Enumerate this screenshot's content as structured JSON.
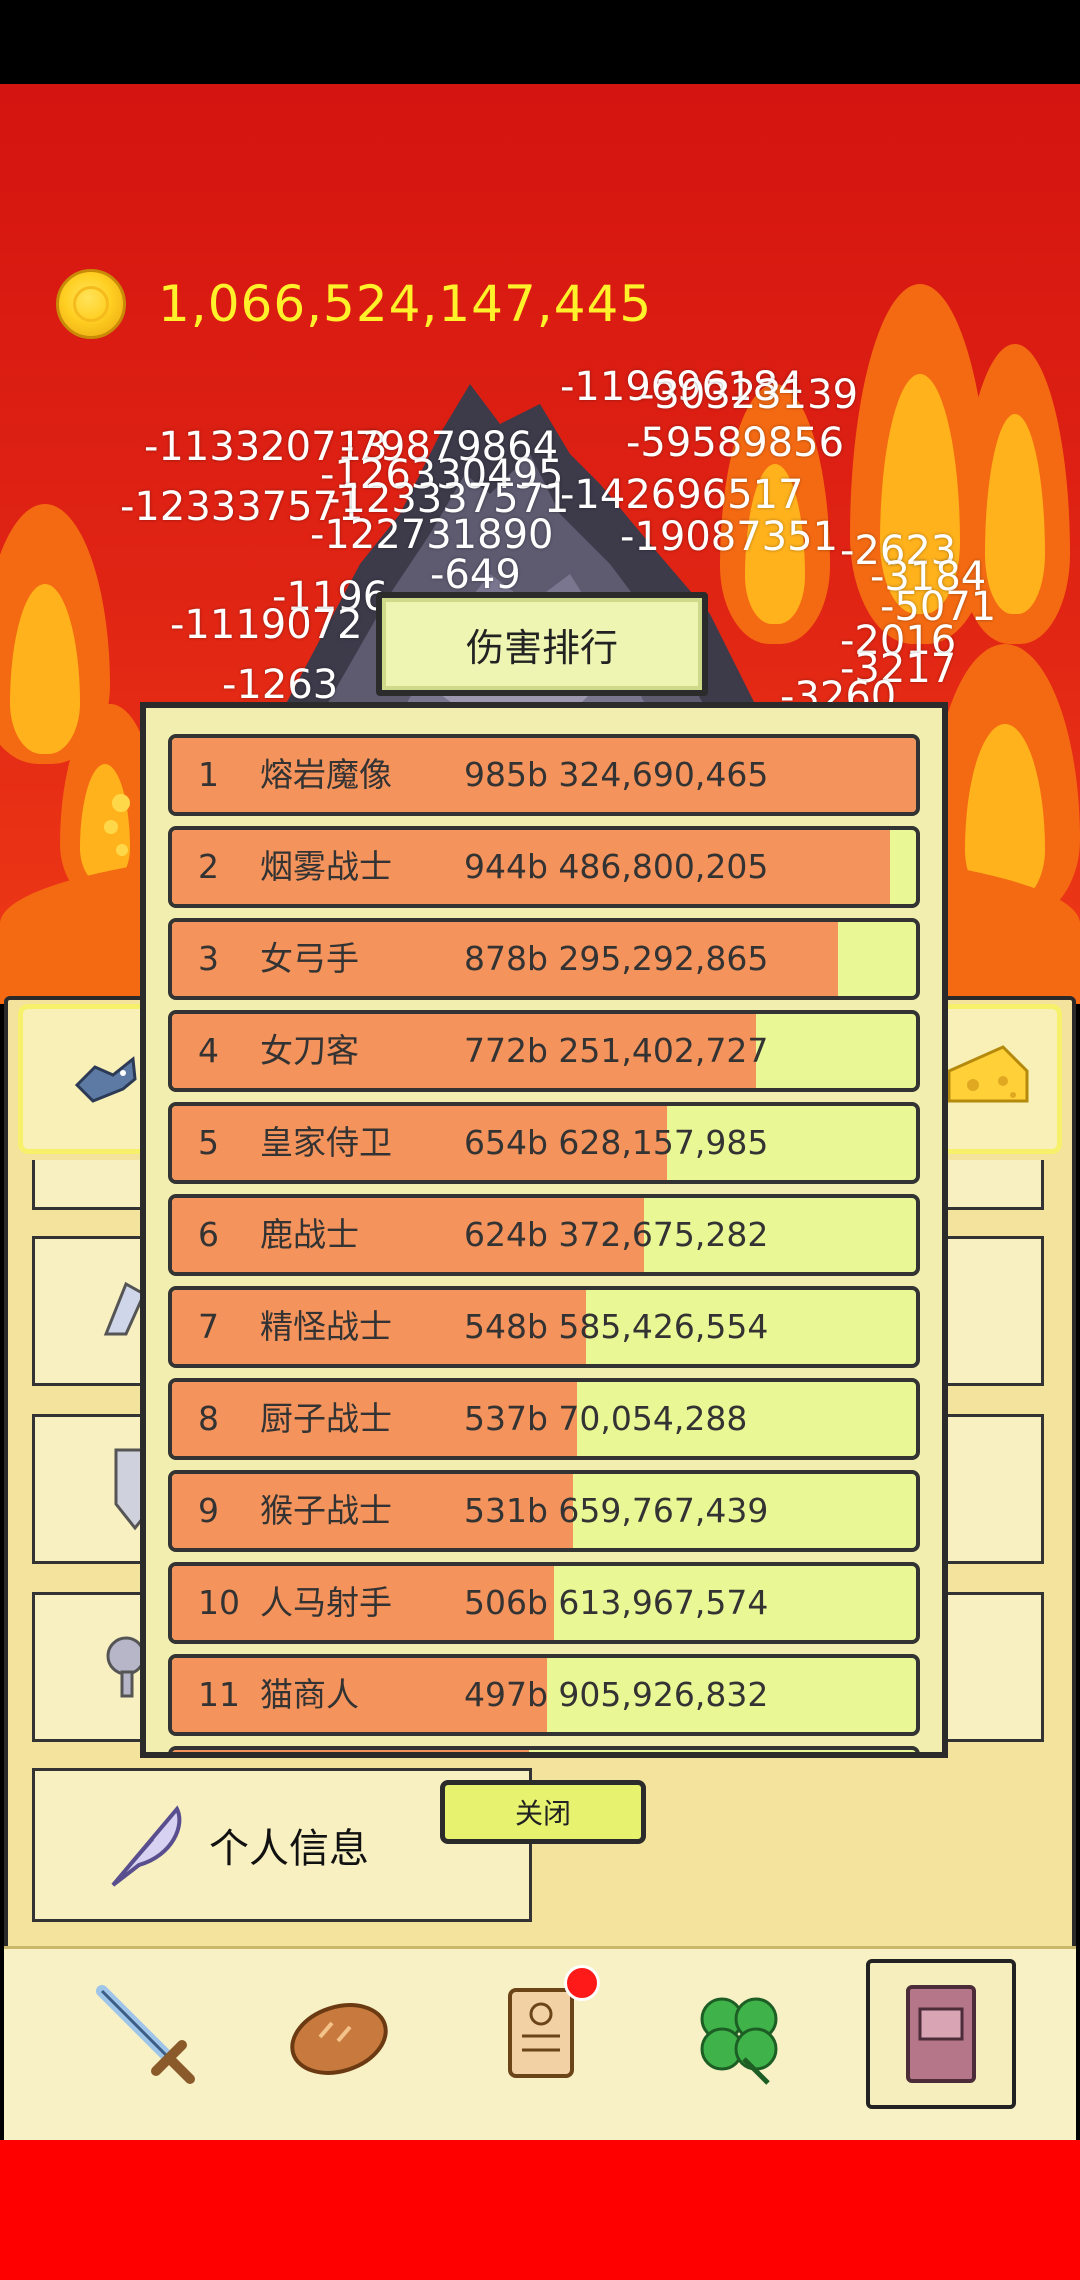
{
  "hud": {
    "gold_amount": "1,066,524,147,445"
  },
  "damage_numbers": [
    "-119696184",
    "-30323139",
    "-113320713",
    "-79879864",
    "-126330495",
    "-59589856",
    "-123337571",
    "-123337571",
    "-142696517",
    "-122731890",
    "-19087351",
    "-1196",
    "-1119072",
    "-649",
    "-1263",
    "-2623",
    "-3184",
    "-5071",
    "-2016",
    "-3217",
    "-3260"
  ],
  "leaderboard": {
    "title": "伤害排行",
    "close_label": "关闭",
    "rows": [
      {
        "rank": "1",
        "name": "熔岩魔像",
        "damage": "985b 324,690,465",
        "ratio": 1.0
      },
      {
        "rank": "2",
        "name": "烟雾战士",
        "damage": "944b 486,800,205",
        "ratio": 0.965
      },
      {
        "rank": "3",
        "name": "女弓手",
        "damage": "878b 295,292,865",
        "ratio": 0.895
      },
      {
        "rank": "4",
        "name": "女刀客",
        "damage": "772b 251,402,727",
        "ratio": 0.785
      },
      {
        "rank": "5",
        "name": "皇家侍卫",
        "damage": "654b 628,157,985",
        "ratio": 0.665
      },
      {
        "rank": "6",
        "name": "鹿战士",
        "damage": "624b 372,675,282",
        "ratio": 0.635
      },
      {
        "rank": "7",
        "name": "精怪战士",
        "damage": "548b 585,426,554",
        "ratio": 0.556
      },
      {
        "rank": "8",
        "name": "厨子战士",
        "damage": "537b 70,054,288",
        "ratio": 0.545
      },
      {
        "rank": "9",
        "name": "猴子战士",
        "damage": "531b 659,767,439",
        "ratio": 0.539
      },
      {
        "rank": "10",
        "name": "人马射手",
        "damage": "506b 613,967,574",
        "ratio": 0.513
      },
      {
        "rank": "11",
        "name": "猫商人",
        "damage": "497b 905,926,832",
        "ratio": 0.504
      }
    ]
  },
  "menu": {
    "profile_label": "个人信息"
  },
  "nav": {
    "items": [
      "sword-icon",
      "bread-icon",
      "scroll-icon",
      "clover-icon",
      "book-icon"
    ],
    "active_index": 4,
    "badge_on": "scroll-icon"
  },
  "colors": {
    "bar_fill": "#f4935b",
    "bar_bg": "#e9f895",
    "gold_text": "#fff12a",
    "scene_red": "#d41410"
  }
}
